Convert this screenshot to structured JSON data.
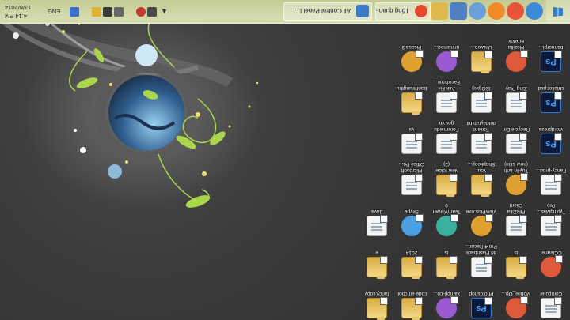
{
  "taskbar": {
    "tasks": [
      {
        "label": "Tổng quan - Goo...",
        "icon": "chrome-icon",
        "color": "#e6482e"
      },
      {
        "label": "All Control Panel I...",
        "icon": "control-panel-icon",
        "color": "#3a7ac8"
      }
    ],
    "pinned": [
      {
        "name": "ie-icon",
        "color": "#3b8bd8"
      },
      {
        "name": "chrome-icon",
        "color": "#e8533a"
      },
      {
        "name": "firefox-icon",
        "color": "#f08a24"
      },
      {
        "name": "paint-icon",
        "color": "#6aa0d8"
      },
      {
        "name": "word-icon",
        "color": "#4f7fc4"
      },
      {
        "name": "explorer-icon",
        "color": "#e0b94a"
      }
    ],
    "language": "ENG",
    "time": "4:14 PM",
    "date": "13/8/2014"
  },
  "desktop_icons": [
    {
      "label": "Computer",
      "type": "doc"
    },
    {
      "label": "CCleaner",
      "type": "round"
    },
    {
      "label": "TypingMas... Pro",
      "type": "doc"
    },
    {
      "label": "Fancy-prod...",
      "type": "doc"
    },
    {
      "label": "wordpress",
      "type": "ps"
    },
    {
      "label": "stricker.psd",
      "type": "ps"
    },
    {
      "label": "bannerpl...",
      "type": "ps"
    },
    {
      "label": "Mobile_Op...",
      "type": "round"
    },
    {
      "label": "ts",
      "type": "folder"
    },
    {
      "label": "FileZilla Client",
      "type": "doc"
    },
    {
      "label": "Tuyển ảnh (new-skin)",
      "type": "round"
    },
    {
      "label": "Recycle Bin",
      "type": "doc"
    },
    {
      "label": "Zing Play",
      "type": "doc"
    },
    {
      "label": "Mozilla Firefox",
      "type": "round"
    },
    {
      "label": "Photoshop",
      "type": "ps"
    },
    {
      "label": "88 Flashback Pro 4 Recor...",
      "type": "doc"
    },
    {
      "label": "ViewPlus.exe",
      "type": "round"
    },
    {
      "label": "Your Shopkeep...",
      "type": "folder"
    },
    {
      "label": "Torrent dotdaytab bit",
      "type": "doc"
    },
    {
      "label": "ISO.pkg",
      "type": "doc"
    },
    {
      "label": "Uniweb...",
      "type": "folder"
    },
    {
      "label": "xampp-co...",
      "type": "round"
    },
    {
      "label": "ts",
      "type": "folder"
    },
    {
      "label": "TeamViewer 9",
      "type": "round"
    },
    {
      "label": "New folder (2)",
      "type": "folder"
    },
    {
      "label": "Forum edu gov.vn",
      "type": "doc"
    },
    {
      "label": "Ask Fix Facebook...",
      "type": "doc"
    },
    {
      "label": "unnamed...",
      "type": "round"
    },
    {
      "label": "code emotion",
      "type": "folder"
    },
    {
      "label": "2014",
      "type": "folder"
    },
    {
      "label": "Skype",
      "type": "round"
    },
    {
      "label": "Microsoft Office Po...",
      "type": "doc"
    },
    {
      "label": "vs",
      "type": "doc"
    },
    {
      "label": "banhtrungthu",
      "type": "folder"
    },
    {
      "label": "Picasa 3",
      "type": "round"
    },
    {
      "label": "fancy.copy",
      "type": "folder"
    },
    {
      "label": "e",
      "type": "folder"
    },
    {
      "label": "Java",
      "type": "doc"
    }
  ],
  "colors": {
    "taskbar": "#c9cf9c",
    "desktop": "#3a3a3a",
    "leaf": "#a9d64a",
    "ps_blue": "#2ea3ff"
  }
}
